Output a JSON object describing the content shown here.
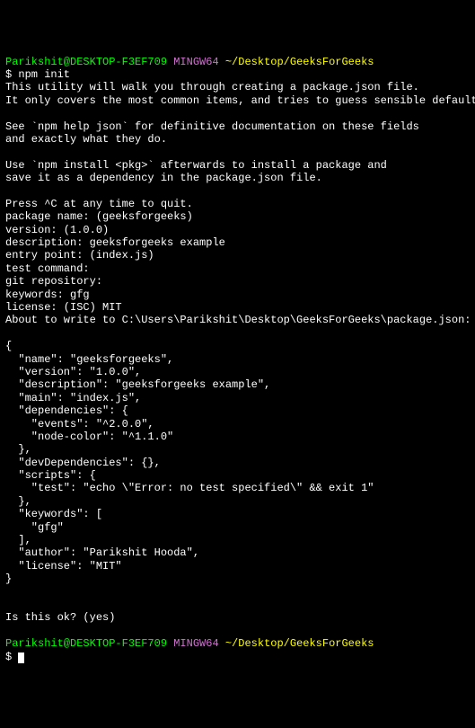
{
  "prompt1": {
    "user_host": "Parikshit@DESKTOP-F3EF709",
    "shell": "MINGW64",
    "path": "~/Desktop/GeeksForGeeks"
  },
  "cmd1": "$ npm init",
  "output": {
    "l1": "This utility will walk you through creating a package.json file.",
    "l2": "It only covers the most common items, and tries to guess sensible defaults.",
    "l3": "See `npm help json` for definitive documentation on these fields",
    "l4": "and exactly what they do.",
    "l5": "Use `npm install <pkg>` afterwards to install a package and",
    "l6": "save it as a dependency in the package.json file.",
    "l7": "Press ^C at any time to quit.",
    "l8": "package name: (geeksforgeeks)",
    "l9": "version: (1.0.0)",
    "l10": "description: geeksforgeeks example",
    "l11": "entry point: (index.js)",
    "l12": "test command:",
    "l13": "git repository:",
    "l14": "keywords: gfg",
    "l15": "license: (ISC) MIT",
    "l16": "About to write to C:\\Users\\Parikshit\\Desktop\\GeeksForGeeks\\package.json:",
    "j1": "{",
    "j2": "  \"name\": \"geeksforgeeks\",",
    "j3": "  \"version\": \"1.0.0\",",
    "j4": "  \"description\": \"geeksforgeeks example\",",
    "j5": "  \"main\": \"index.js\",",
    "j6": "  \"dependencies\": {",
    "j7": "    \"events\": \"^2.0.0\",",
    "j8": "    \"node-color\": \"^1.1.0\"",
    "j9": "  },",
    "j10": "  \"devDependencies\": {},",
    "j11": "  \"scripts\": {",
    "j12": "    \"test\": \"echo \\\"Error: no test specified\\\" && exit 1\"",
    "j13": "  },",
    "j14": "  \"keywords\": [",
    "j15": "    \"gfg\"",
    "j16": "  ],",
    "j17": "  \"author\": \"Parikshit Hooda\",",
    "j18": "  \"license\": \"MIT\"",
    "j19": "}",
    "confirm": "Is this ok? (yes)"
  },
  "prompt2": {
    "user_host": "Parikshit@DESKTOP-F3EF709",
    "shell": "MINGW64",
    "path": "~/Desktop/GeeksForGeeks"
  },
  "cmd2": "$ "
}
